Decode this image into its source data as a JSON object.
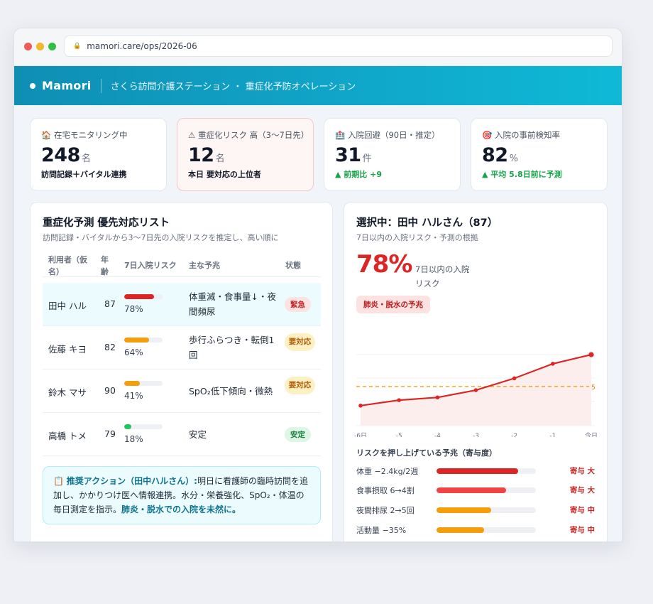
{
  "browser": {
    "url": "mamori.care/ops/2026-06"
  },
  "app": {
    "brand": "Mamori",
    "subtitle": "さくら訪問介護ステーション ・ 重症化予防オペレーション"
  },
  "kpis": [
    {
      "icon": "🏠",
      "label": "在宅モニタリング中",
      "value": "248",
      "unit": "名",
      "note": "訪問記録＋バイタル連携"
    },
    {
      "icon": "⚠",
      "label": "重症化リスク 高（3〜7日先）",
      "value": "12",
      "unit": "名",
      "note": "本日 要対応の上位者"
    },
    {
      "icon": "🏥",
      "label": "入院回避（90日・推定）",
      "value": "31",
      "unit": "件",
      "note": "▲ 前期比 +9"
    },
    {
      "icon": "🎯",
      "label": "入院の事前検知率",
      "value": "82",
      "unit": "%",
      "note": "▲ 平均 5.8日前に予測"
    }
  ],
  "list": {
    "title": "重症化予測 優先対応リスト",
    "subtitle": "訪問記録・バイタルから3〜7日先の入院リスクを推定し、高い順に",
    "headers": {
      "name": "利用者（仮名）",
      "age": "年齢",
      "risk": "7日入院リスク",
      "sign": "主な予兆",
      "status": "状態"
    },
    "rows": [
      {
        "name": "田中 ハル",
        "age": "87",
        "risk_pct": "78%",
        "risk": 0.78,
        "color": "#dc2626",
        "sign": "体重減・食事量↓・夜間頻尿",
        "status": "緊急"
      },
      {
        "name": "佐藤 キヨ",
        "age": "82",
        "risk_pct": "64%",
        "risk": 0.64,
        "color": "#f59e0b",
        "sign": "歩行ふらつき・転倒1回",
        "status": "要対応"
      },
      {
        "name": "鈴木 マサ",
        "age": "90",
        "risk_pct": "41%",
        "risk": 0.41,
        "color": "#f59e0b",
        "sign": "SpO₂低下傾向・微熱",
        "status": "要対応"
      },
      {
        "name": "高橋 トメ",
        "age": "79",
        "risk_pct": "18%",
        "risk": 0.18,
        "color": "#22c55e",
        "sign": "安定",
        "status": "安定"
      }
    ],
    "action": {
      "head": "推奨アクション（田中ハルさん）:",
      "body": "明日に看護師の臨時訪問を追加し、かかりつけ医へ情報連携。水分・栄養強化、SpO₂・体温の毎日測定を指示。",
      "tail": "肺炎・脱水での入院を未然に。"
    }
  },
  "detail": {
    "title": "選択中：田中 ハルさん（87）",
    "subtitle": "7日以内の入院リスク・予測の根拠",
    "big_value": "78%",
    "big_label": "7日以内の入院リスク",
    "tag": "肺炎・脱水の予兆",
    "factors_title": "リスクを押し上げている予兆（寄与度）",
    "factors": [
      {
        "label": "体重 −2.4kg/2週",
        "level": "寄与 大",
        "share": 0.82,
        "color": "#dc2626"
      },
      {
        "label": "食事摂取 6→4割",
        "level": "寄与 大",
        "share": 0.7,
        "color": "#ef4444"
      },
      {
        "label": "夜間排尿 2→5回",
        "level": "寄与 中",
        "share": 0.55,
        "color": "#f59e0b"
      },
      {
        "label": "活動量 −35%",
        "level": "寄与 中",
        "share": 0.48,
        "color": "#f59e0b"
      }
    ]
  },
  "chart_data": {
    "type": "line",
    "title": "",
    "x": [
      "-6日",
      "-5",
      "-4",
      "-3",
      "-2",
      "-1",
      "今日"
    ],
    "series": [
      {
        "values": [
          22,
          28,
          31,
          39,
          52,
          68,
          78
        ]
      }
    ],
    "threshold": 43,
    "threshold_label": "5",
    "ylim": [
      0,
      100
    ],
    "xlabel": "",
    "ylabel": "",
    "grid": true
  }
}
